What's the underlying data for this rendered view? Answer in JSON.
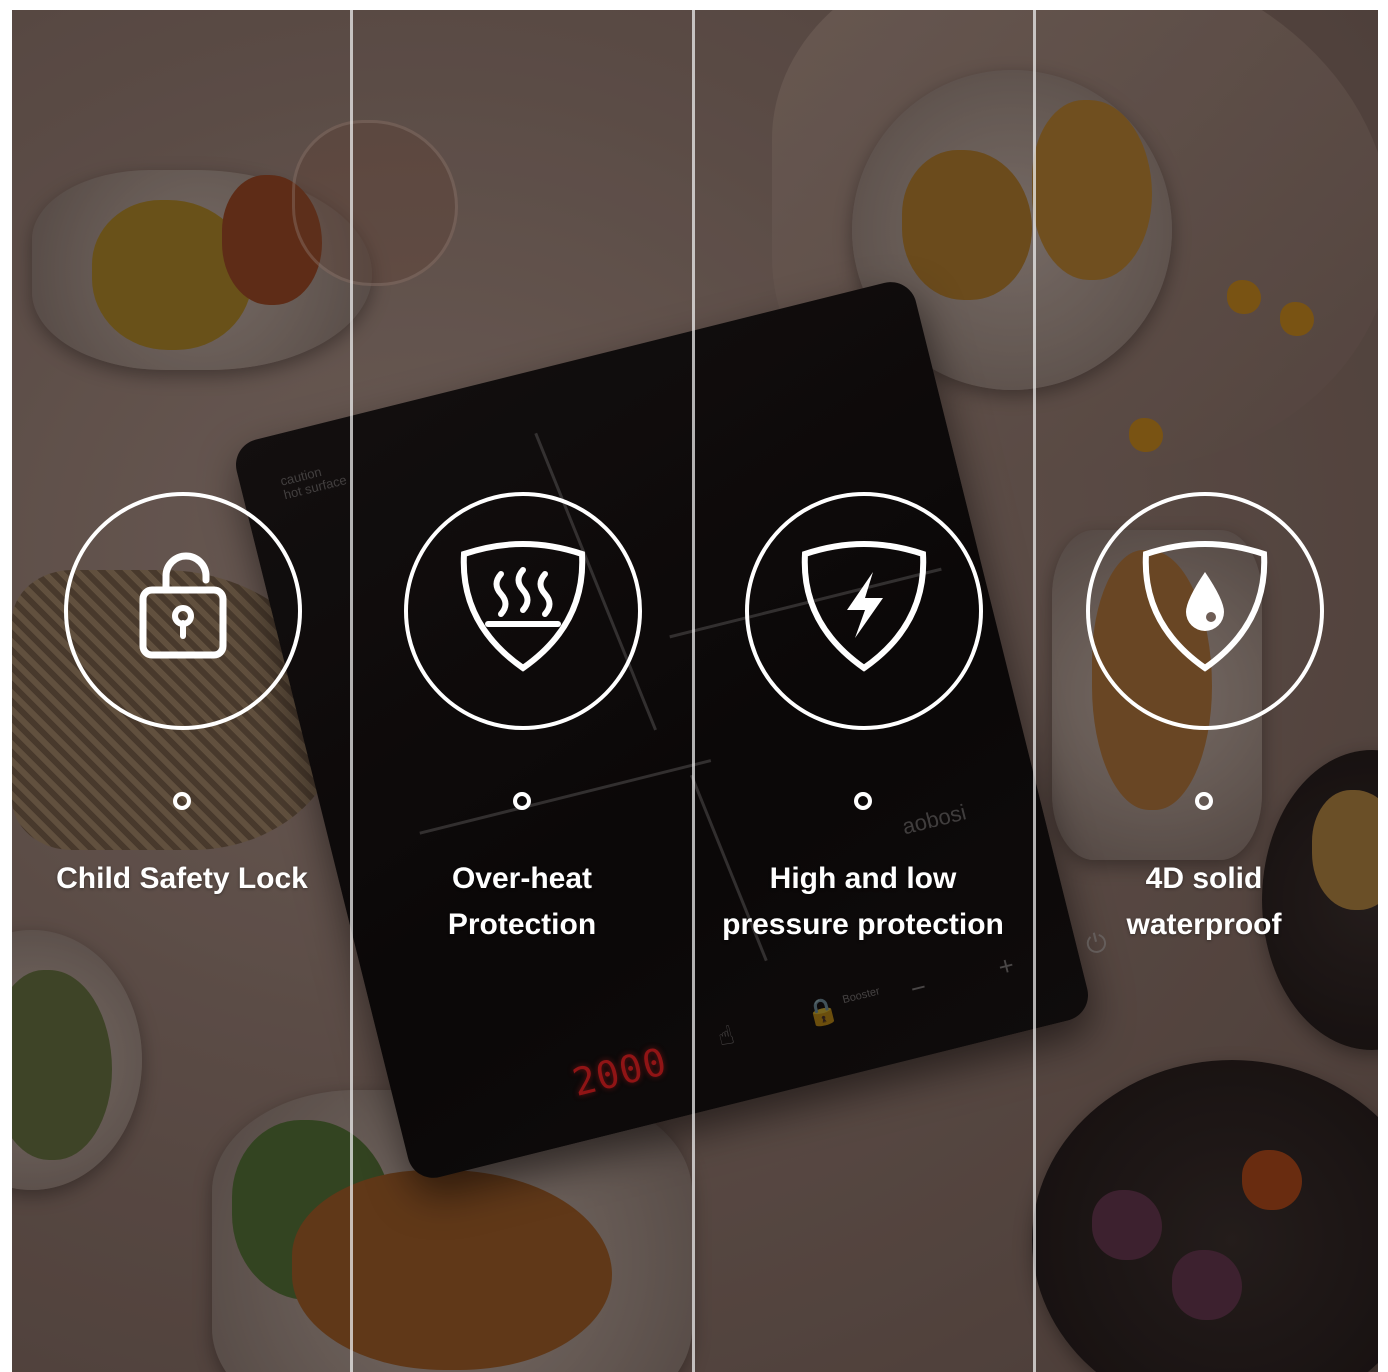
{
  "colors": {
    "overlay": "#6e5d55",
    "icon_stroke": "#ffffff",
    "led_red": "#c0181a"
  },
  "cooktop": {
    "display_value": "2000",
    "brand_text": "aobosi",
    "caution_line1": "caution",
    "caution_line2": "hot surface",
    "booster_label": "Booster"
  },
  "features": [
    {
      "icon": "unlocked-padlock-icon",
      "line1": "Child Safety Lock",
      "line2": ""
    },
    {
      "icon": "heat-shield-icon",
      "line1": "Over-heat",
      "line2": "Protection"
    },
    {
      "icon": "lightning-shield-icon",
      "line1": "High and low",
      "line2": "pressure protection"
    },
    {
      "icon": "water-drop-shield-icon",
      "line1": "4D solid",
      "line2": "waterproof"
    }
  ]
}
